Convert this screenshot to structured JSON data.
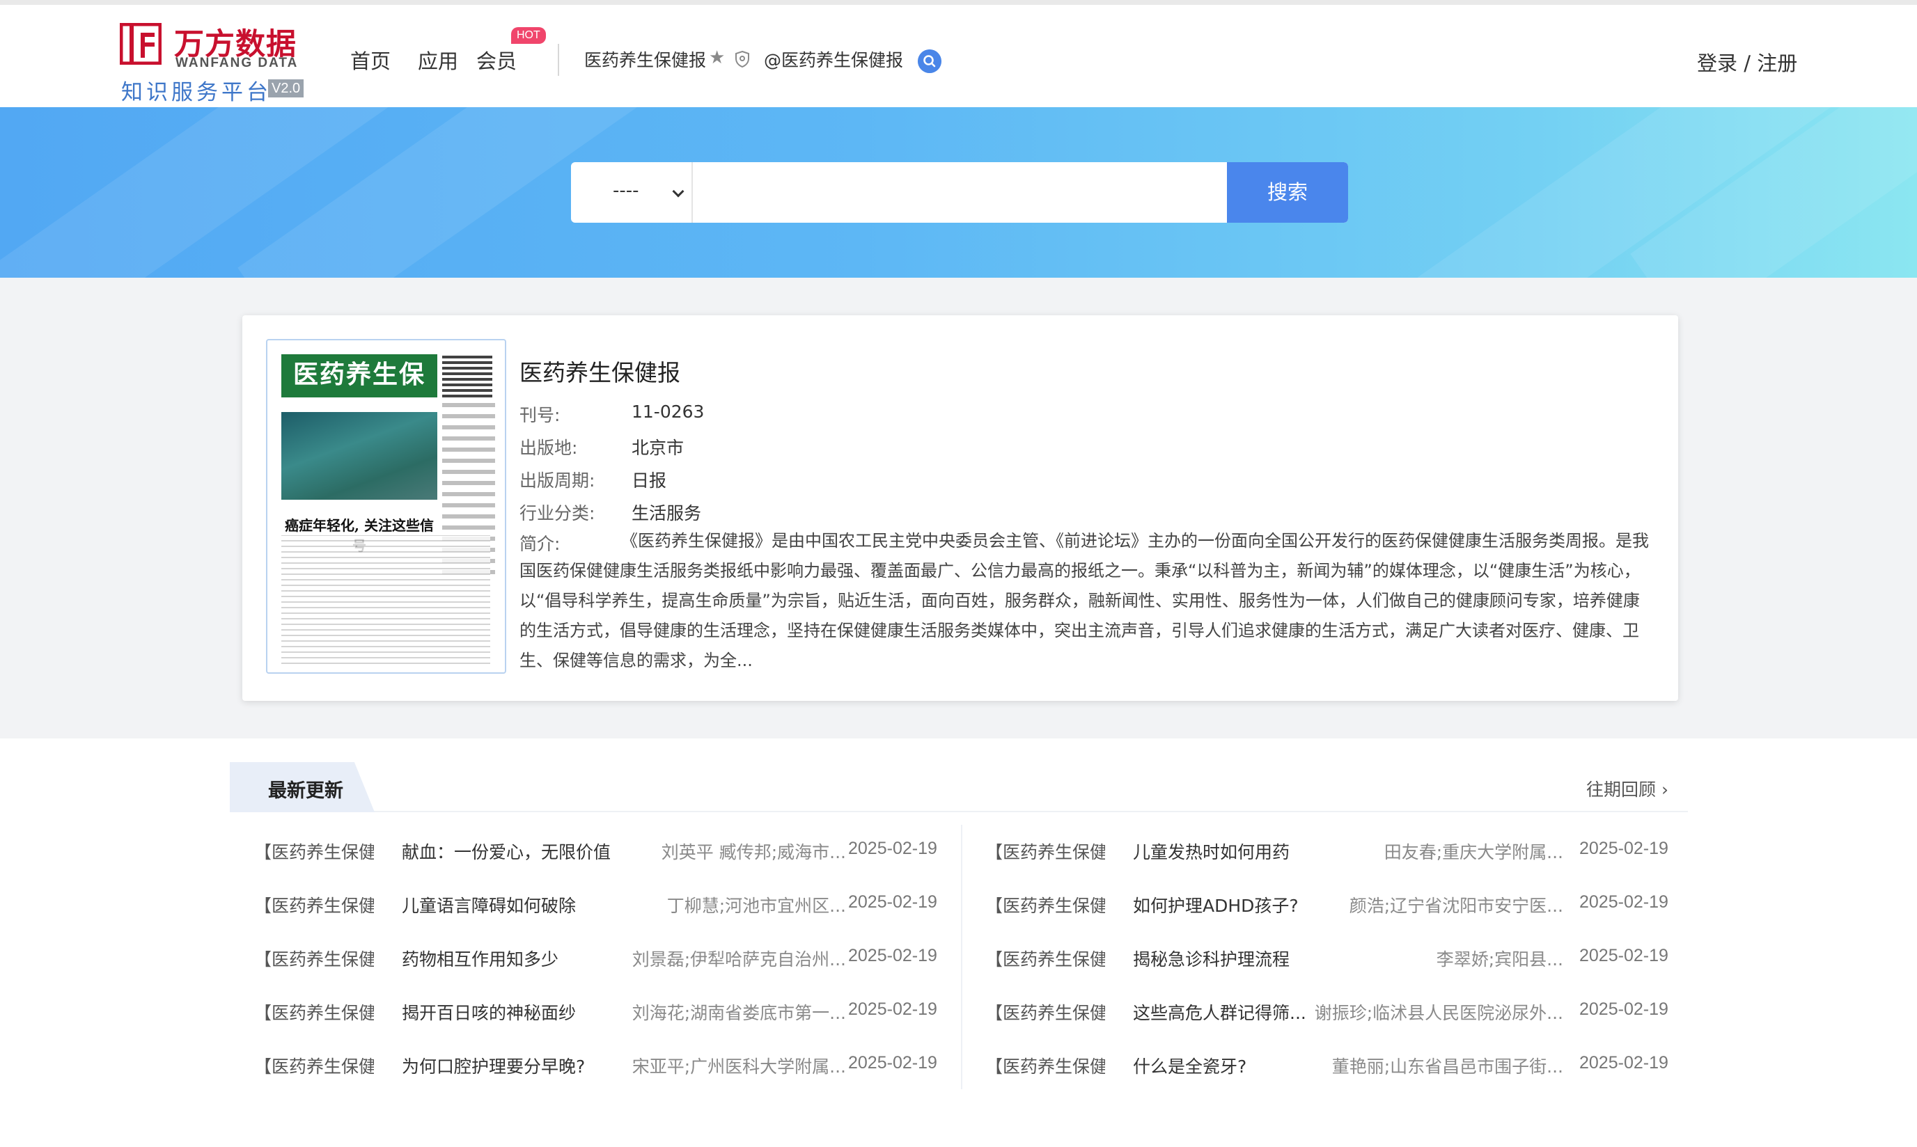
{
  "brand": {
    "name_cn": "万方数据",
    "name_en": "WANFANG DATA",
    "subtitle": "知识服务平台",
    "version": "V2.0"
  },
  "nav": {
    "home": "首页",
    "app": "应用",
    "vip": "会员",
    "hot_badge": "HOT",
    "crumb_title": "医药养生保健报",
    "crumb_at": "@医药养生保健报",
    "login": "登录 / 注册"
  },
  "search": {
    "select_value": "----",
    "input_value": "",
    "button_label": "搜索"
  },
  "publication": {
    "title": "医药养生保健报",
    "cover_masthead": "医药养生保健报",
    "cover_headline": "癌症年轻化, 关注这些信号",
    "fields": [
      {
        "label": "刊号:",
        "value": "11-0263"
      },
      {
        "label": "出版地:",
        "value": "北京市"
      },
      {
        "label": "出版周期:",
        "value": "日报"
      },
      {
        "label": "行业分类:",
        "value": "生活服务"
      }
    ],
    "intro_label": "简介:",
    "intro_text": "《医药养生保健报》是由中国农工民主党中央委员会主管、《前进论坛》主办的一份面向全国公开发行的医药保健健康生活服务类周报。是我国医药保健健康生活服务类报纸中影响力最强、覆盖面最广、公信力最高的报纸之一。秉承“以科普为主，新闻为辅”的媒体理念，以“健康生活”为核心，以“倡导科学养生，提高生命质量”为宗旨，贴近生活，面向百姓，服务群众，融新闻性、实用性、服务性为一体，人们做自己的健康顾问专家，培养健康的生活方式，倡导健康的生活理念，坚持在保健健康生活服务类媒体中，突出主流声音，引导人们追求健康的生活方式，满足广大读者对医疗、健康、卫生、保健等信息的需求，为全..."
  },
  "latest": {
    "section_title": "最新更新",
    "more_label": "往期回顾 ›",
    "left": [
      {
        "source": "【医药养生保健",
        "title": "献血：一份爱心，无限价值",
        "author": "刘英平 臧传邦;威海市...",
        "date": "2025-02-19"
      },
      {
        "source": "【医药养生保健",
        "title": "儿童语言障碍如何破除",
        "author": "丁柳慧;河池市宜州区...",
        "date": "2025-02-19"
      },
      {
        "source": "【医药养生保健",
        "title": "药物相互作用知多少",
        "author": "刘景磊;伊犁哈萨克自治州...",
        "date": "2025-02-19"
      },
      {
        "source": "【医药养生保健",
        "title": "揭开百日咳的神秘面纱",
        "author": "刘海花;湖南省娄底市第一...",
        "date": "2025-02-19"
      },
      {
        "source": "【医药养生保健",
        "title": "为何口腔护理要分早晚?",
        "author": "宋亚平;广州医科大学附属...",
        "date": "2025-02-19"
      }
    ],
    "right": [
      {
        "source": "【医药养生保健",
        "title": "儿童发热时如何用药",
        "author": "田友春;重庆大学附属...",
        "date": "2025-02-19"
      },
      {
        "source": "【医药养生保健",
        "title": "如何护理ADHD孩子?",
        "author": "颜浩;辽宁省沈阳市安宁医...",
        "date": "2025-02-19"
      },
      {
        "source": "【医药养生保健",
        "title": "揭秘急诊科护理流程",
        "author": "李翠娇;宾阳县...",
        "date": "2025-02-19"
      },
      {
        "source": "【医药养生保健",
        "title": "这些高危人群记得筛...",
        "author": "谢振珍;临沭县人民医院泌尿外...",
        "date": "2025-02-19"
      },
      {
        "source": "【医药养生保健",
        "title": "什么是全瓷牙?",
        "author": "董艳丽;山东省昌邑市围子街...",
        "date": "2025-02-19"
      }
    ]
  },
  "colors": {
    "brand_red": "#c8102e",
    "accent_blue": "#4a86ec",
    "hot_pink": "#f0456b"
  },
  "icons": [
    "wanfang-logo-icon",
    "star-icon",
    "shield-icon",
    "search-icon",
    "chevron-down-icon"
  ]
}
